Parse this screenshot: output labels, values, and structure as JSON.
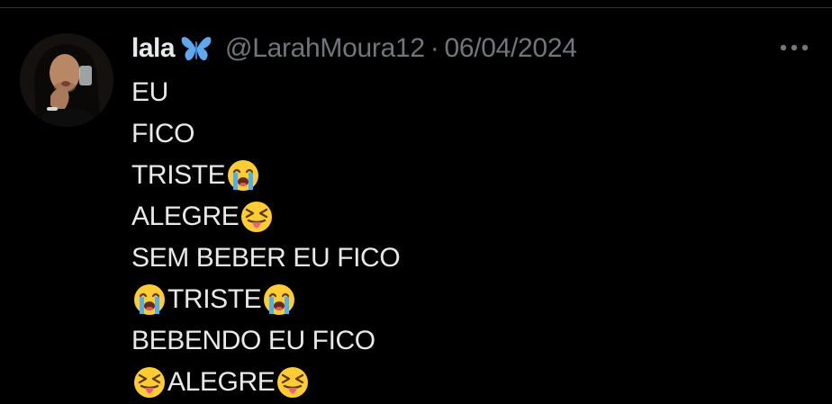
{
  "post": {
    "author": {
      "display_name": "lala",
      "name_emoji_icon": "butterfly-icon",
      "handle": "@LarahMoura12",
      "separator": "·",
      "date": "06/04/2024"
    },
    "more_icon": "more-horizontal-icon",
    "lines": [
      {
        "text": "EU"
      },
      {
        "text": "FICO"
      },
      {
        "text": "TRISTE",
        "after_emoji": "loudly-crying-face-icon"
      },
      {
        "text": "ALEGRE",
        "after_emoji": "squinting-tongue-face-icon"
      },
      {
        "text": "SEM BEBER EU FICO"
      },
      {
        "text": "TRISTE",
        "before_emoji": "loudly-crying-face-icon",
        "after_emoji": "loudly-crying-face-icon"
      },
      {
        "text": "BEBENDO EU FICO"
      },
      {
        "text": "ALEGRE",
        "before_emoji": "squinting-tongue-face-icon",
        "after_emoji": "squinting-tongue-face-icon"
      }
    ]
  },
  "colors": {
    "background": "#000000",
    "primary_text": "#e7e9ea",
    "secondary_text": "#71767b",
    "butterfly": "#5fa8ee",
    "emoji_yellow": "#ffcc33"
  }
}
